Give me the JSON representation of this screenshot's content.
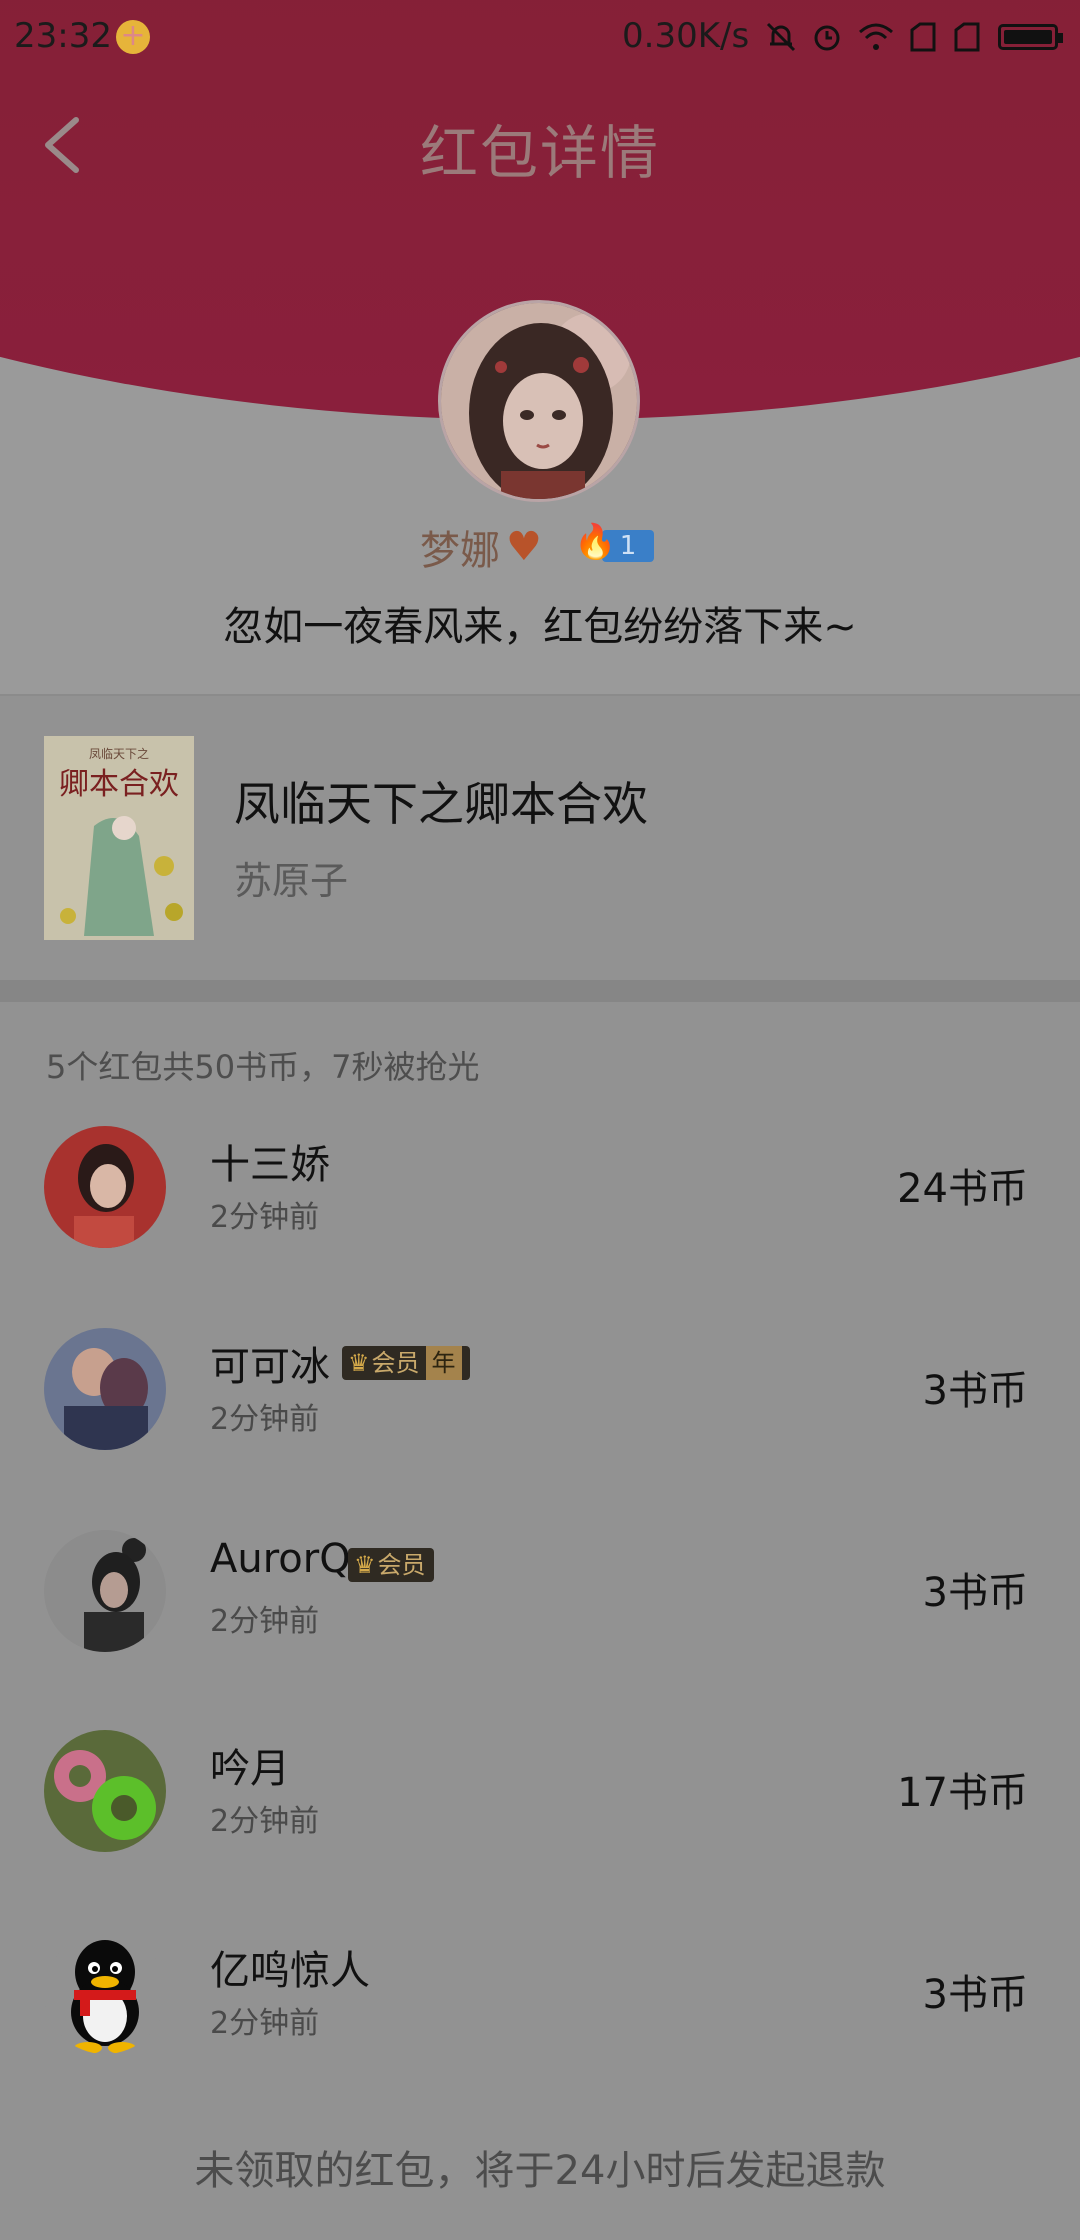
{
  "status_bar": {
    "time": "23:32",
    "net_speed": "0.30K/s"
  },
  "header": {
    "title": "红包详情"
  },
  "sender": {
    "name": "梦娜",
    "level": "1",
    "greeting": "忽如一夜春风来，红包纷纷落下来~"
  },
  "book": {
    "title": "凤临天下之卿本合欢",
    "author": "苏原子",
    "cover_title": "卿本合欢",
    "cover_subtitle": "凤临天下之"
  },
  "summary": "5个红包共50书币，7秒被抢光",
  "recipients": [
    {
      "name": "十三娇",
      "time": "2分钟前",
      "amount": "24书币",
      "badge": ""
    },
    {
      "name": "可可冰",
      "time": "2分钟前",
      "amount": "3书币",
      "badge": "会员",
      "badge_extra": "年"
    },
    {
      "name": "AurorQ",
      "time": "2分钟前",
      "amount": "3书币",
      "badge": "会员"
    },
    {
      "name": "吟月",
      "time": "2分钟前",
      "amount": "17书币",
      "badge": ""
    },
    {
      "name": "亿鸣惊人",
      "time": "2分钟前",
      "amount": "3书币",
      "badge": ""
    }
  ],
  "footer_note": "未领取的红包，将于24小时后发起退款",
  "colors": {
    "header_red": "#7f2230",
    "overlay_gray": "#929292",
    "vip_gold": "#c9a96b"
  }
}
